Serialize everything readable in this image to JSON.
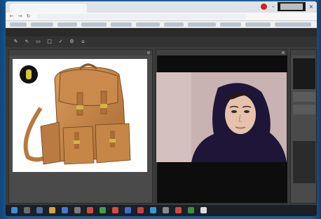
{
  "browser": {
    "tab_title": "",
    "address": ""
  },
  "app": {
    "title": "",
    "right_status": ""
  },
  "colors": {
    "desktop_blue": "#1f5f96",
    "app_dark": "#3b3b3b",
    "record_red": "#d32020",
    "bag_leather": "#c8894b"
  },
  "icons": {
    "minimize": "minimize-icon",
    "maximize": "maximize-icon",
    "close": "close-icon",
    "back": "back-arrow-icon",
    "forward": "forward-arrow-icon",
    "reload": "reload-icon"
  }
}
